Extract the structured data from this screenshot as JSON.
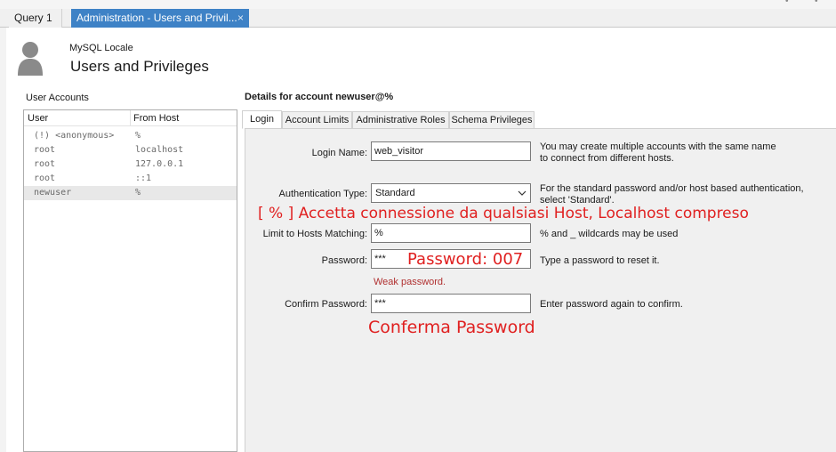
{
  "tabs": {
    "query_tab": "Query 1",
    "admin_tab": "Administration - Users and Privil...",
    "close_glyph": "×"
  },
  "header": {
    "server_name": "MySQL Locale",
    "title": "Users and Privileges"
  },
  "accounts": {
    "label": "User Accounts",
    "col_user": "User",
    "col_host": "From Host",
    "rows": [
      {
        "user": "(!) <anonymous>",
        "host": "%"
      },
      {
        "user": "root",
        "host": "localhost"
      },
      {
        "user": "root",
        "host": "127.0.0.1"
      },
      {
        "user": "root",
        "host": "::1"
      },
      {
        "user": "newuser",
        "host": "%"
      }
    ]
  },
  "details": {
    "title": "Details for account newuser@%",
    "tabs": [
      "Login",
      "Account Limits",
      "Administrative Roles",
      "Schema Privileges"
    ]
  },
  "form": {
    "login_name_label": "Login Name:",
    "login_name_value": "web_visitor",
    "login_help_1": "You may create multiple accounts with the same name",
    "login_help_2": "to connect from different hosts.",
    "auth_label": "Authentication Type:",
    "auth_value": "Standard",
    "auth_help_1": "For the standard password and/or host based authentication,",
    "auth_help_2": "select 'Standard'.",
    "limit_label": "Limit to Hosts Matching:",
    "limit_value": "%",
    "limit_help": "% and _ wildcards may be used",
    "password_label": "Password:",
    "password_value": "***",
    "password_help": "Type a password to reset it.",
    "weak_text": "Weak password.",
    "confirm_label": "Confirm Password:",
    "confirm_value": "***",
    "confirm_help": "Enter password again to confirm."
  },
  "annotations": {
    "host_note": "[ % ] Accetta connessione da qualsiasi Host, Localhost compreso",
    "password_note": "Password: 007",
    "confirm_note": "Conferma Password"
  },
  "colors": {
    "active_tab": "#3e82c6",
    "annotation": "#e02020",
    "weak_password": "#b03030"
  },
  "icons": {
    "avatar": "user-silhouette-icon",
    "dropdown": "chevron-down-icon"
  }
}
